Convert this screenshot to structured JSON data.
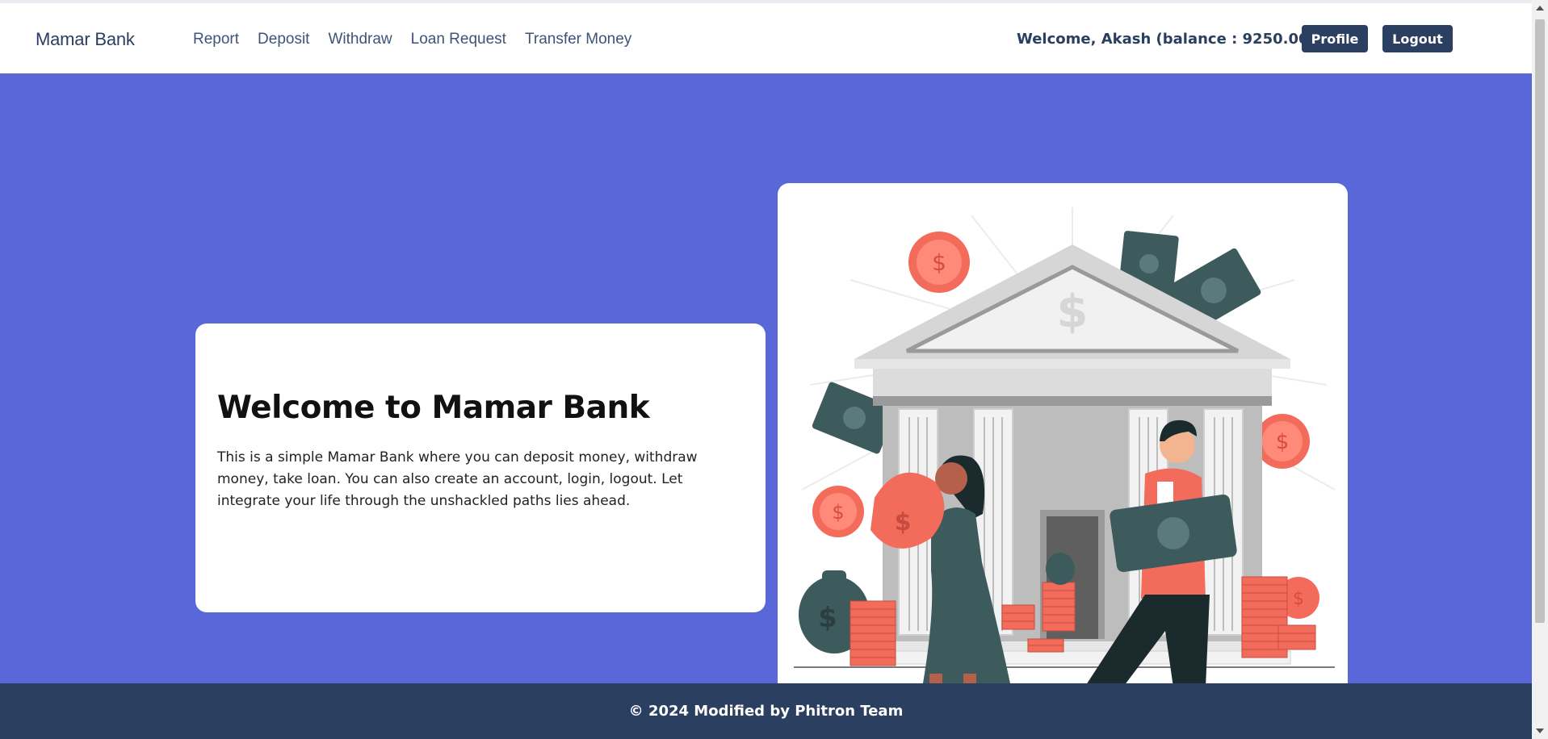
{
  "navbar": {
    "brand": "Mamar Bank",
    "links": [
      "Report",
      "Deposit",
      "Withdraw",
      "Loan Request",
      "Transfer Money"
    ],
    "welcome": "Welcome, Akash (balance : 9250.00)",
    "profile_label": "Profile",
    "logout_label": "Logout"
  },
  "hero": {
    "title": "Welcome to Mamar Bank",
    "description": "This is a simple Mamar Bank where you can deposit money, withdraw money, take loan. You can also create an account, login, logout. Let integrate your life through the unshackled paths lies ahead."
  },
  "footer": {
    "text": "© 2024 Modified by Phitron Team"
  },
  "colors": {
    "hero_bg": "#5a67d8",
    "navy": "#2b3f61",
    "coin": "#f26b5b"
  }
}
